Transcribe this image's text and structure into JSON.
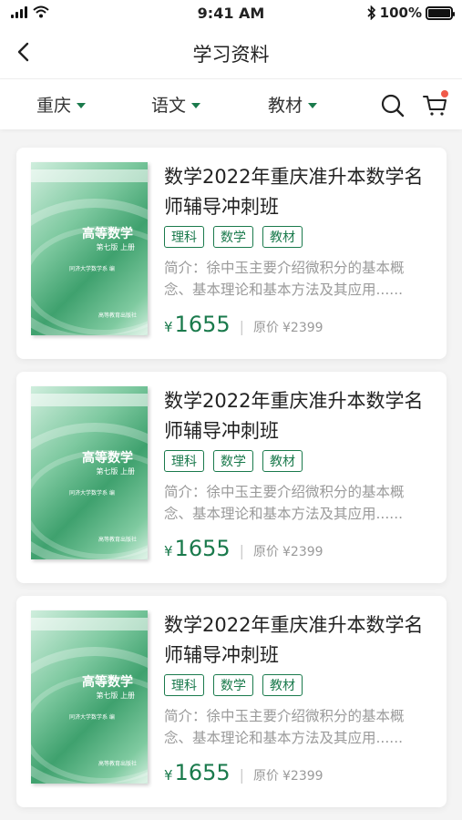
{
  "status_bar": {
    "time": "9:41 AM",
    "battery": "100%",
    "battery_level": 1.0
  },
  "nav": {
    "title": "学习资料",
    "back_icon": "chevron-left-icon"
  },
  "filters": [
    {
      "label": "重庆"
    },
    {
      "label": "语文"
    },
    {
      "label": "教材"
    }
  ],
  "icons": {
    "search": "search-icon",
    "cart": "cart-icon"
  },
  "colors": {
    "accent": "#1a7a4c",
    "badge": "#f05a4a"
  },
  "products": [
    {
      "title": "数学2022年重庆准升本数学名师辅导冲刺班",
      "tags": [
        "理科",
        "数学",
        "教材"
      ],
      "desc": "简介：徐中玉主要介绍微积分的基本概念、基本理论和基本方法及其应用......",
      "currency": "¥",
      "price": "1655",
      "orig_label": "原价",
      "orig_price": "¥2399",
      "cover": {
        "title": "高等数学",
        "edition": "第七版 上册",
        "author": "同济大学数学系 编",
        "publisher": "高等教育出版社"
      }
    },
    {
      "title": "数学2022年重庆准升本数学名师辅导冲刺班",
      "tags": [
        "理科",
        "数学",
        "教材"
      ],
      "desc": "简介：徐中玉主要介绍微积分的基本概念、基本理论和基本方法及其应用......",
      "currency": "¥",
      "price": "1655",
      "orig_label": "原价",
      "orig_price": "¥2399",
      "cover": {
        "title": "高等数学",
        "edition": "第七版 上册",
        "author": "同济大学数学系 编",
        "publisher": "高等教育出版社"
      }
    },
    {
      "title": "数学2022年重庆准升本数学名师辅导冲刺班",
      "tags": [
        "理科",
        "数学",
        "教材"
      ],
      "desc": "简介：徐中玉主要介绍微积分的基本概念、基本理论和基本方法及其应用......",
      "currency": "¥",
      "price": "1655",
      "orig_label": "原价",
      "orig_price": "¥2399",
      "cover": {
        "title": "高等数学",
        "edition": "第七版 上册",
        "author": "同济大学数学系 编",
        "publisher": "高等教育出版社"
      }
    }
  ]
}
